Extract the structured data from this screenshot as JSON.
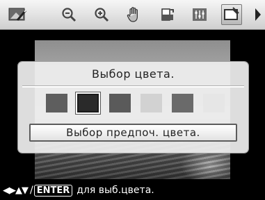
{
  "toolbar": {
    "icons": [
      "photo-edit-icon",
      "zoom-out-icon",
      "zoom-in-icon",
      "hand-move-icon",
      "rotate-icon",
      "adjust-icon",
      "color-frame-icon"
    ],
    "selected": "color-frame-icon"
  },
  "dialog": {
    "title": "Выбор цвета.",
    "swatches": [
      "#5e5e5e",
      "#2a2a2a",
      "#5a5a5a",
      "#d2d2d2",
      "#6a6a6a",
      "#e6e6e6"
    ],
    "selected_swatch_index": 1,
    "preferred_button_label": "Выбор предпоч. цвета."
  },
  "hint": {
    "arrows": "◀▶▲▼",
    "slash": "/",
    "enter_label": "ENTER",
    "text": "для выб.цвета."
  }
}
